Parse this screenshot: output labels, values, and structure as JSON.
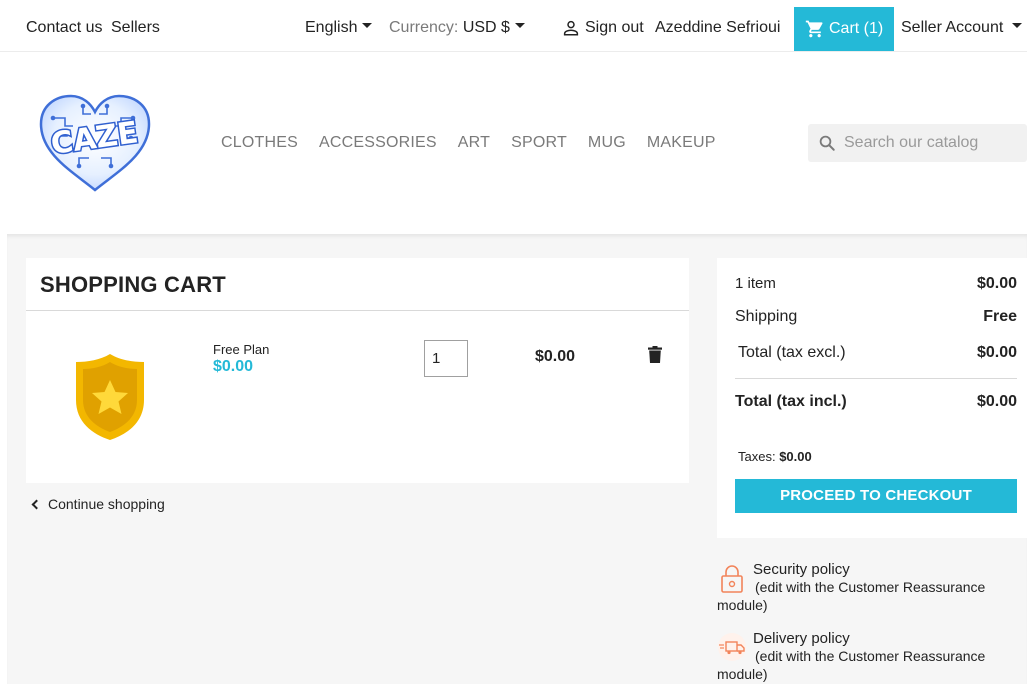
{
  "topbar": {
    "contact": "Contact us",
    "sellers": "Sellers",
    "language": "English",
    "currency_label": "Currency:",
    "currency_value": "USD $",
    "sign_out": "Sign out",
    "user_name": "Azeddine Sefrioui",
    "cart_label": "Cart (1)",
    "seller_account": "Seller Account"
  },
  "header": {
    "logo_alt": "CAZE",
    "menu": [
      "CLOTHES",
      "ACCESSORIES",
      "ART",
      "SPORT",
      "MUG",
      "MAKEUP"
    ],
    "search_placeholder": "Search our catalog"
  },
  "cart": {
    "title": "SHOPPING CART",
    "items": [
      {
        "name": "Free Plan",
        "price": "$0.00",
        "quantity": "1",
        "total": "$0.00"
      }
    ],
    "continue_label": "Continue shopping"
  },
  "summary": {
    "items_label": "1 item",
    "items_value": "$0.00",
    "shipping_label": "Shipping",
    "shipping_value": "Free",
    "total_excl_label": "Total (tax excl.)",
    "total_excl_value": "$0.00",
    "total_incl_label": "Total (tax incl.)",
    "total_incl_value": "$0.00",
    "taxes_label": "Taxes:",
    "taxes_value": "$0.00",
    "checkout_label": "PROCEED TO CHECKOUT"
  },
  "reassurance": [
    {
      "title": "Security policy",
      "line1": "(edit with the Customer Reassurance",
      "line2": "module)",
      "icon": "lock-icon"
    },
    {
      "title": "Delivery policy",
      "line1": "(edit with the Customer Reassurance",
      "line2": "module)",
      "icon": "truck-icon"
    }
  ],
  "colors": {
    "accent": "#24b9d7",
    "background": "#f6f6f6",
    "text": "#232323"
  }
}
